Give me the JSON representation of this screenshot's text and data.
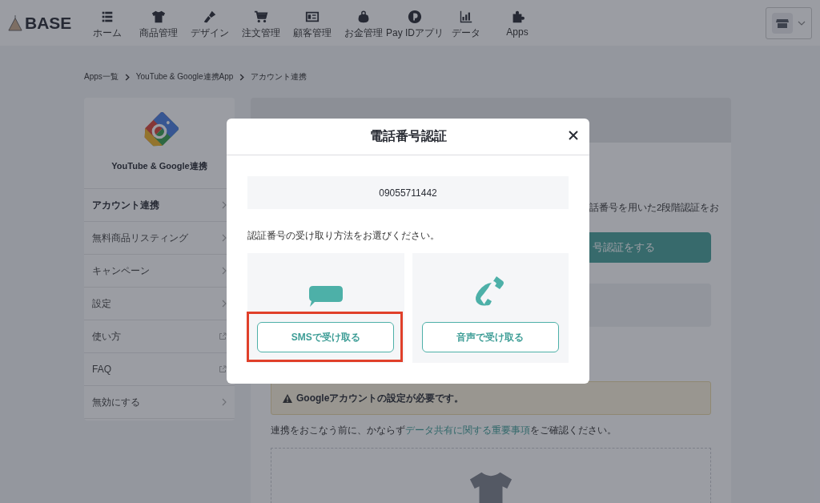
{
  "header": {
    "logo": "BASE",
    "nav": [
      {
        "label": "ホーム"
      },
      {
        "label": "商品管理"
      },
      {
        "label": "デザイン"
      },
      {
        "label": "注文管理"
      },
      {
        "label": "顧客管理"
      },
      {
        "label": "お金管理"
      },
      {
        "label": "Pay IDアプリ"
      },
      {
        "label": "データ"
      },
      {
        "label": "Apps"
      }
    ]
  },
  "breadcrumb": [
    "Apps一覧",
    "YouTube & Google連携App",
    "アカウント連携"
  ],
  "sidebar": {
    "title": "YouTube & Google連携",
    "items": [
      {
        "label": "アカウント連携",
        "kind": "page",
        "selected": true
      },
      {
        "label": "無料商品リスティング",
        "kind": "page",
        "selected": false
      },
      {
        "label": "キャンペーン",
        "kind": "page",
        "selected": false
      },
      {
        "label": "設定",
        "kind": "page",
        "selected": false
      },
      {
        "label": "使い方",
        "kind": "external",
        "selected": false
      },
      {
        "label": "FAQ",
        "kind": "external",
        "selected": false
      },
      {
        "label": "無効にする",
        "kind": "page",
        "selected": false
      }
    ]
  },
  "main": {
    "partial_text": "話番号を用いた2段階認証をお",
    "partial_button": "号認証をする",
    "warning": "Googleアカウントの設定が必要です。",
    "notice": {
      "before": "連携をおこなう前に、かならず",
      "link": "データ共有に関する重要事項",
      "after": "をご確認ください。"
    }
  },
  "modal": {
    "title": "電話番号認証",
    "phone": "09055711442",
    "instruction": "認証番号の受け取り方法をお選びください。",
    "options": [
      {
        "kind": "sms",
        "button": "SMSで受け取る",
        "highlighted": true
      },
      {
        "kind": "voice",
        "button": "音声で受け取る",
        "highlighted": false
      }
    ]
  }
}
